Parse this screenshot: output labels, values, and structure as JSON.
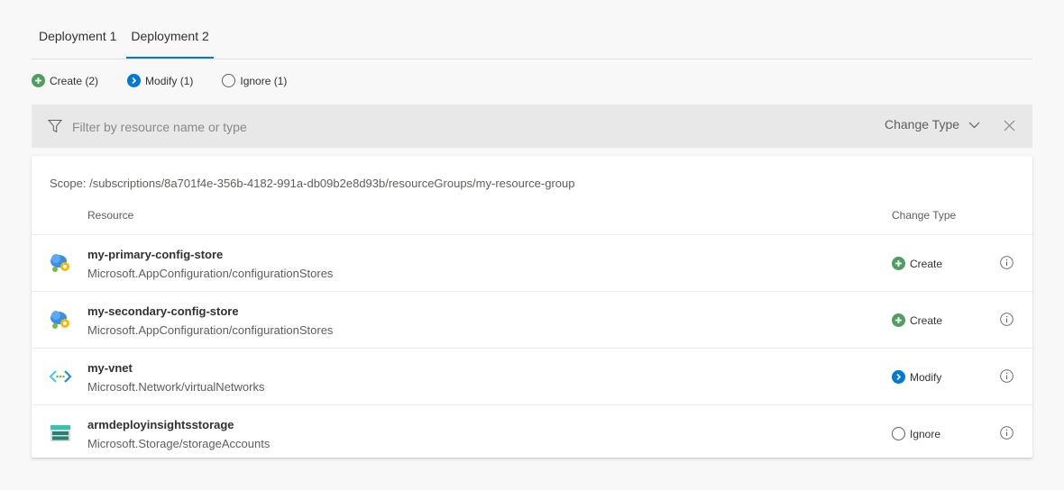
{
  "tabs": [
    {
      "label": "Deployment 1",
      "active": false
    },
    {
      "label": "Deployment 2",
      "active": true
    }
  ],
  "legend": {
    "create": "Create (2)",
    "modify": "Modify (1)",
    "ignore": "Ignore (1)"
  },
  "filter": {
    "placeholder": "Filter by resource name or type",
    "value": "",
    "change_type_label": "Change Type"
  },
  "scope": "Scope: /subscriptions/8a701f4e-356b-4182-991a-db09b2e8d93b/resourceGroups/my-resource-group",
  "columns": {
    "resource": "Resource",
    "change_type": "Change Type"
  },
  "rows": [
    {
      "name": "my-primary-config-store",
      "type": "Microsoft.AppConfiguration/configurationStores",
      "icon": "app-configuration-icon",
      "change": "Create"
    },
    {
      "name": "my-secondary-config-store",
      "type": "Microsoft.AppConfiguration/configurationStores",
      "icon": "app-configuration-icon",
      "change": "Create"
    },
    {
      "name": "my-vnet",
      "type": "Microsoft.Network/virtualNetworks",
      "icon": "virtual-network-icon",
      "change": "Modify"
    },
    {
      "name": "armdeployinsightsstorage",
      "type": "Microsoft.Storage/storageAccounts",
      "icon": "storage-account-icon",
      "change": "Ignore"
    }
  ],
  "colors": {
    "accent": "#0078d4",
    "create": "#4f9e5e",
    "modify": "#0078d4",
    "ignore": "#605e5c"
  }
}
